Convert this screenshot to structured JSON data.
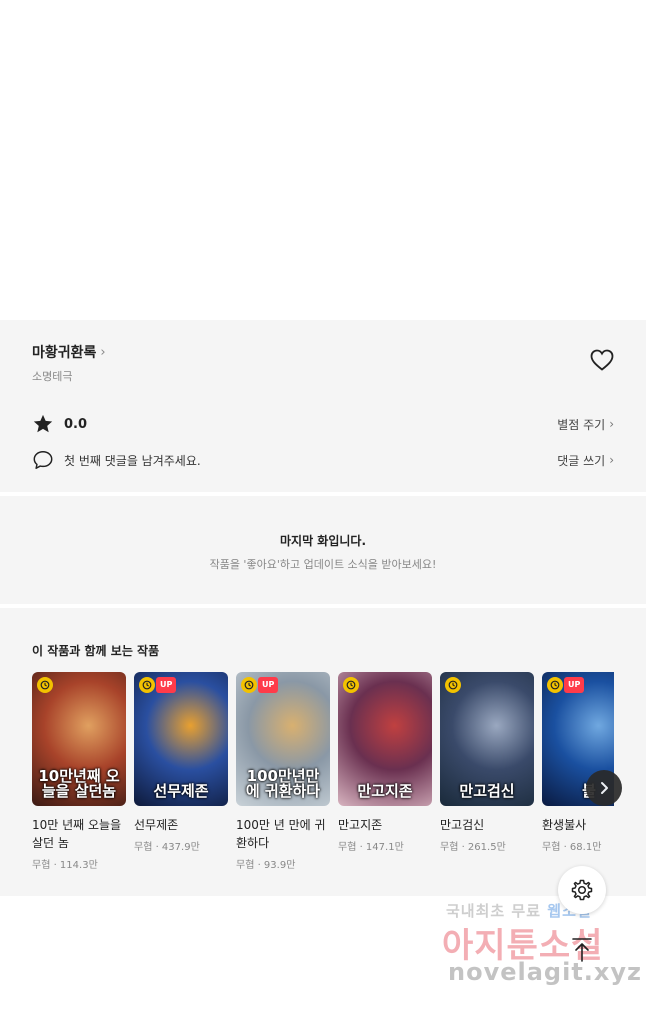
{
  "work": {
    "title": "마황귀환록",
    "author": "소명테극",
    "rating": "0.0",
    "rate_label": "별점 주기",
    "comment_prompt": "첫 번째 댓글을 남겨주세요.",
    "comment_label": "댓글 쓰기"
  },
  "last_episode": {
    "title": "마지막 화입니다.",
    "subtitle": "작품을 '좋아요'하고 업데이트 소식을 받아보세요!"
  },
  "recommend": {
    "heading": "이 작품과 함께 보는 작품",
    "up_label": "UP",
    "items": [
      {
        "name": "10만 년째 오늘을 살던 놈",
        "meta": "무협 · 114.3만",
        "up": false,
        "thumb_text": "10만년째 오늘을 살던놈",
        "colors": [
          "#3a1a14",
          "#a8432a",
          "#e0a060"
        ]
      },
      {
        "name": "선무제존",
        "meta": "무협 · 437.9만",
        "up": true,
        "thumb_text": "선무제존",
        "colors": [
          "#0e1a3a",
          "#2a4fa0",
          "#e8a030"
        ]
      },
      {
        "name": "100만 년 만에 귀환하다",
        "meta": "무협 · 93.9만",
        "up": true,
        "thumb_text": "100만년만에 귀환하다",
        "colors": [
          "#c9d2d8",
          "#8a98a6",
          "#d8b070"
        ]
      },
      {
        "name": "만고지존",
        "meta": "무협 · 147.1만",
        "up": false,
        "thumb_text": "만고지존",
        "colors": [
          "#d8b4c0",
          "#6a3050",
          "#c04040"
        ]
      },
      {
        "name": "만고검신",
        "meta": "무협 · 261.5만",
        "up": false,
        "thumb_text": "만고검신",
        "colors": [
          "#1a2a3a",
          "#3a4a6a",
          "#9aa8c0"
        ]
      },
      {
        "name": "환생불사",
        "meta": "무협 · 68.1만",
        "up": true,
        "thumb_text": "불",
        "colors": [
          "#0a1a40",
          "#1a50a0",
          "#70a8e0"
        ]
      }
    ]
  },
  "watermark": {
    "line1_a": "국내최초 무료",
    "line1_b": "웹소설",
    "line2": "아지툰소설",
    "line3": "novelagit.xyz"
  },
  "icons": {
    "heart": "heart-outline-icon",
    "star": "star-icon",
    "comment": "speech-bubble-icon",
    "clock": "clock-icon",
    "next": "chevron-right-icon",
    "settings": "gear-icon",
    "top": "arrow-up-icon"
  }
}
